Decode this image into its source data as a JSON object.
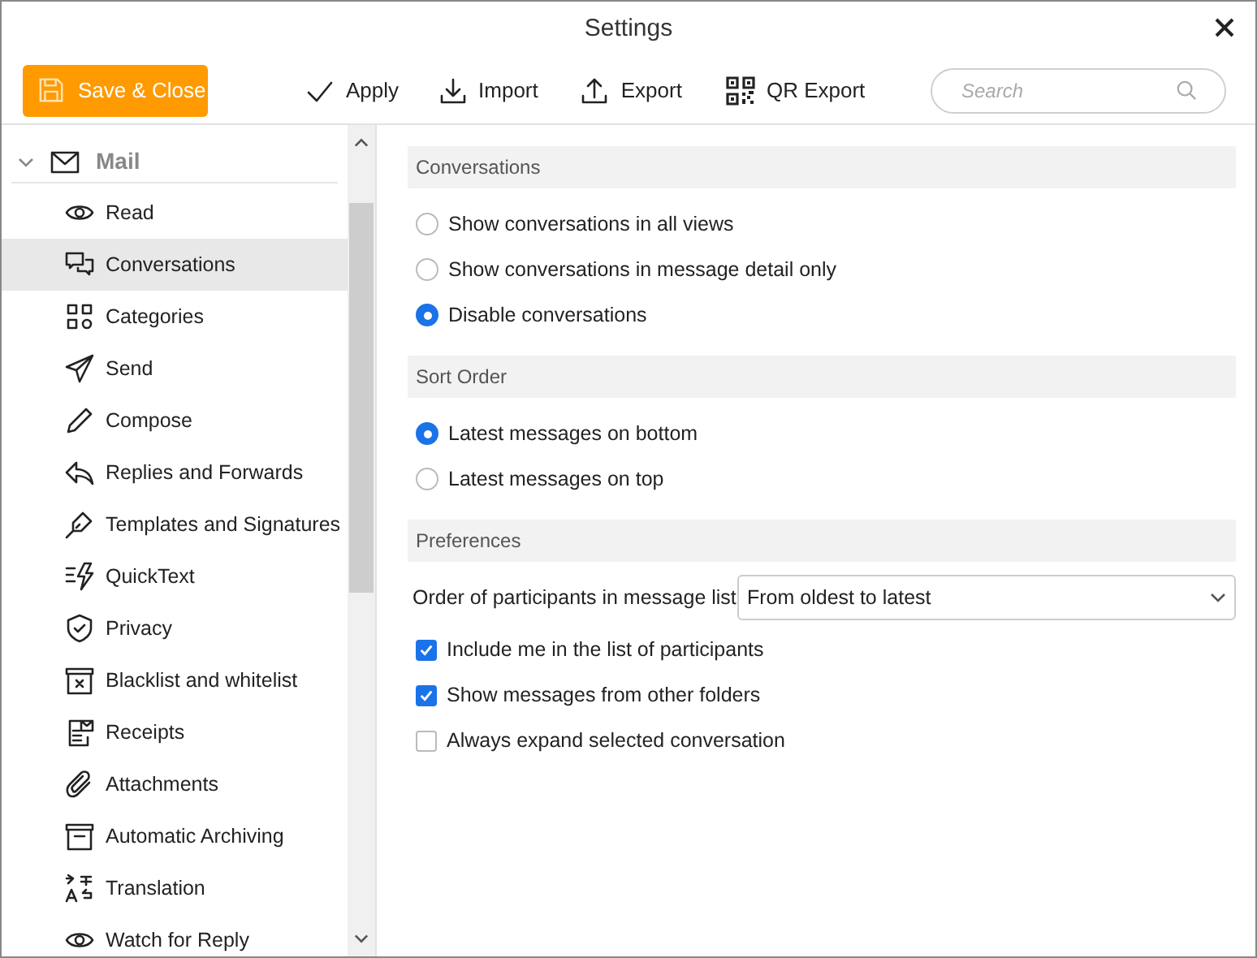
{
  "window": {
    "title": "Settings"
  },
  "toolbar": {
    "save_button": "Save & Close",
    "buttons": [
      "Apply",
      "Import",
      "Export",
      "QR Export"
    ],
    "search": {
      "placeholder": "Search"
    }
  },
  "sidebar": {
    "group": {
      "label": "Mail",
      "expanded": true
    },
    "items": [
      {
        "label": "Read",
        "selected": false
      },
      {
        "label": "Conversations",
        "selected": true
      },
      {
        "label": "Categories",
        "selected": false
      },
      {
        "label": "Send",
        "selected": false
      },
      {
        "label": "Compose",
        "selected": false
      },
      {
        "label": "Replies and Forwards",
        "selected": false
      },
      {
        "label": "Templates and Signatures",
        "selected": false
      },
      {
        "label": "QuickText",
        "selected": false
      },
      {
        "label": "Privacy",
        "selected": false
      },
      {
        "label": "Blacklist and whitelist",
        "selected": false
      },
      {
        "label": "Receipts",
        "selected": false
      },
      {
        "label": "Attachments",
        "selected": false
      },
      {
        "label": "Automatic Archiving",
        "selected": false
      },
      {
        "label": "Translation",
        "selected": false
      },
      {
        "label": "Watch for Reply",
        "selected": false
      }
    ]
  },
  "sections": [
    {
      "title": "Conversations",
      "options": [
        {
          "kind": "radio",
          "label": "Show conversations in all views",
          "selected": false
        },
        {
          "kind": "radio",
          "label": "Show conversations in message detail only",
          "selected": false
        },
        {
          "kind": "radio",
          "label": "Disable conversations",
          "selected": true
        }
      ]
    },
    {
      "title": "Sort Order",
      "options": [
        {
          "kind": "radio",
          "label": "Latest messages on bottom",
          "selected": true
        },
        {
          "kind": "radio",
          "label": "Latest messages on top",
          "selected": false
        }
      ]
    },
    {
      "title": "Preferences",
      "options": [
        {
          "kind": "dropdown",
          "label": "Order of participants in message list",
          "value": "From oldest to latest"
        },
        {
          "kind": "checkbox",
          "label": "Include me in the list of participants",
          "checked": true
        },
        {
          "kind": "checkbox",
          "label": "Show messages from other folders",
          "checked": true
        },
        {
          "kind": "checkbox",
          "label": "Always expand selected conversation",
          "checked": false
        }
      ]
    }
  ]
}
